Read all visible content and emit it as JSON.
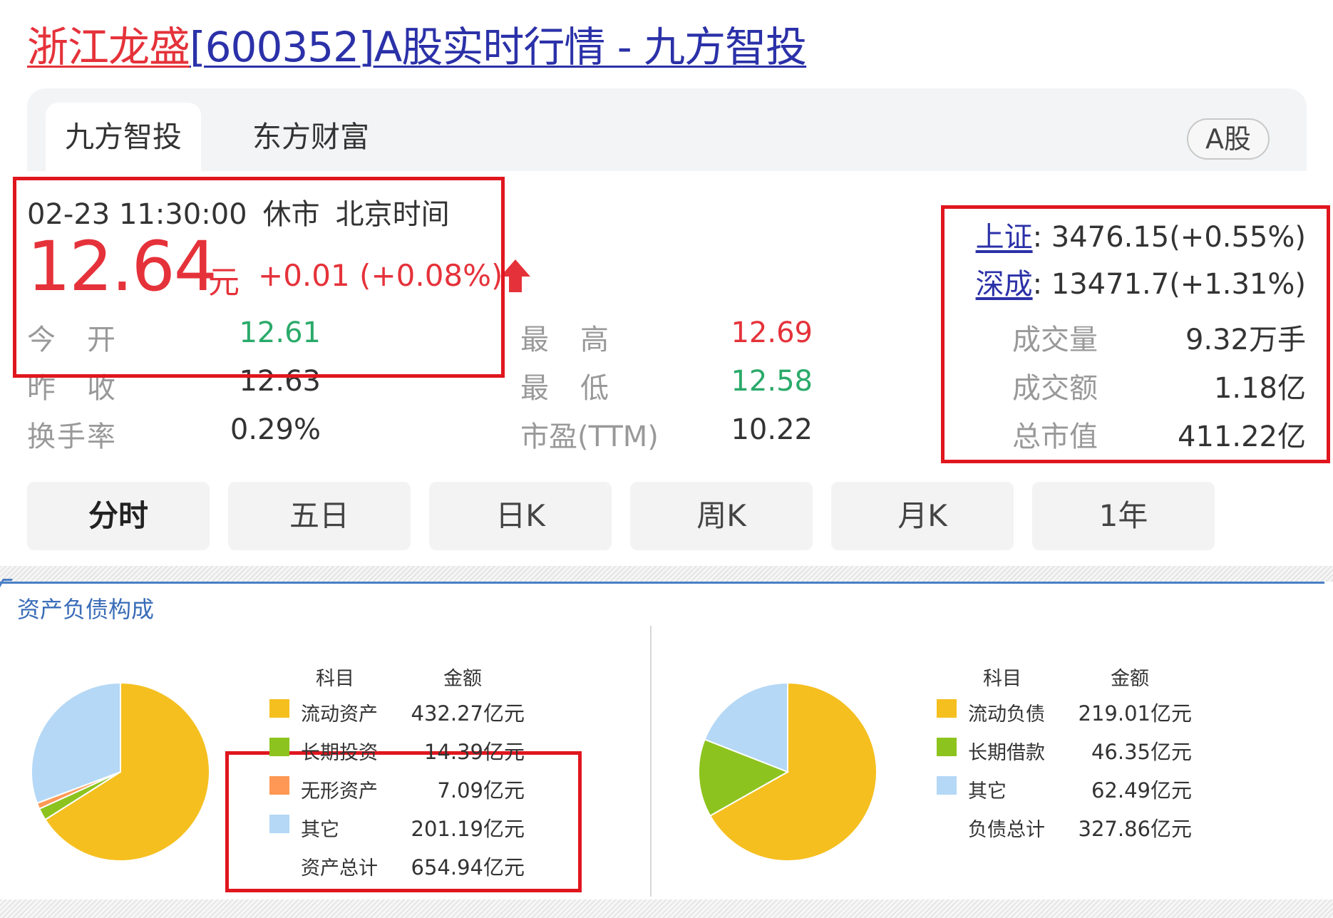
{
  "title": {
    "name": "浙江龙盛",
    "rest": "[600352]A股实时行情 - 九方智投"
  },
  "tabs": {
    "jiufang": "九方智投",
    "dongfang": "东方财富",
    "badge": "A股"
  },
  "quote": {
    "date_time": "02-23 11:30:00",
    "status": "休市",
    "tz": "北京时间",
    "price": "12.64",
    "unit": "元",
    "change": "+0.01 (+0.08%)"
  },
  "stats": {
    "open_label": "今　开",
    "open": "12.61",
    "prev_label": "昨　收",
    "prev": "12.63",
    "turnover_label": "换手率",
    "turnover": "0.29%",
    "high_label": "最　高",
    "high": "12.69",
    "low_label": "最　低",
    "low": "12.58",
    "pe_label": "市盈(TTM)",
    "pe": "10.22"
  },
  "index": {
    "sh_name": "上证",
    "sh_val": ": 3476.15(+0.55%)",
    "sz_name": "深成",
    "sz_val": ": 13471.7(+1.31%)",
    "volume_label": "成交量",
    "volume": "9.32万手",
    "amount_label": "成交额",
    "amount": "1.18亿",
    "mcap_label": "总市值",
    "mcap": "411.22亿"
  },
  "periods": [
    "分时",
    "五日",
    "日K",
    "周K",
    "月K",
    "1年"
  ],
  "section_title": "资产负债构成",
  "colors": {
    "red": "#e5323a",
    "green": "#2aaa6a",
    "blue_link": "#2b31a8",
    "yellow": "#f5bf1f",
    "leaf": "#8dc31e",
    "orange": "#ff9854",
    "lightblue": "#b4d8f6"
  },
  "chart_data": [
    {
      "type": "pie",
      "head": {
        "item": "科目",
        "amount": "金额"
      },
      "slices": [
        {
          "name": "流动资产",
          "amount": "432.27亿元",
          "value": 432.27,
          "color": "#f5bf1f"
        },
        {
          "name": "长期投资",
          "amount": "14.39亿元",
          "value": 14.39,
          "color": "#8dc31e"
        },
        {
          "name": "无形资产",
          "amount": "7.09亿元",
          "value": 7.09,
          "color": "#ff9854"
        },
        {
          "name": "其它",
          "amount": "201.19亿元",
          "value": 201.19,
          "color": "#b4d8f6"
        }
      ],
      "total": {
        "name": "资产总计",
        "amount": "654.94亿元"
      }
    },
    {
      "type": "pie",
      "head": {
        "item": "科目",
        "amount": "金额"
      },
      "slices": [
        {
          "name": "流动负债",
          "amount": "219.01亿元",
          "value": 219.01,
          "color": "#f5bf1f"
        },
        {
          "name": "长期借款",
          "amount": "46.35亿元",
          "value": 46.35,
          "color": "#8dc31e"
        },
        {
          "name": "其它",
          "amount": "62.49亿元",
          "value": 62.49,
          "color": "#b4d8f6"
        }
      ],
      "total": {
        "name": "负债总计",
        "amount": "327.86亿元"
      }
    }
  ]
}
